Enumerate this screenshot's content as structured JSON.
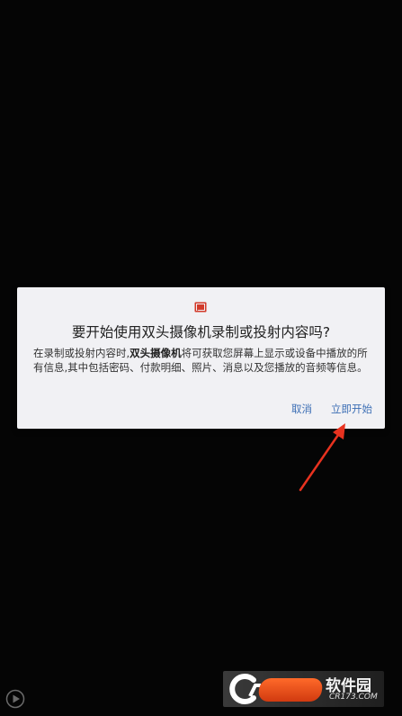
{
  "dialog": {
    "icon": "cast-icon",
    "title": "要开始使用双头摄像机录制或投射内容吗?",
    "body_prefix": "在录制或投射内容时,",
    "app_name": "双头摄像机",
    "body_suffix": "将可获取您屏幕上显示或设备中播放的所有信息,其中包括密码、付款明细、照片、消息以及您播放的音频等信息。",
    "cancel_label": "取消",
    "start_label": "立即开始"
  },
  "watermark": {
    "brand": "软件园",
    "url": "CR173.COM"
  },
  "colors": {
    "background": "#050505",
    "dialog_bg": "#f1f1f4",
    "button_text": "#3d6fb5",
    "cast_icon": "#d23a2a",
    "arrow": "#e8321f"
  }
}
